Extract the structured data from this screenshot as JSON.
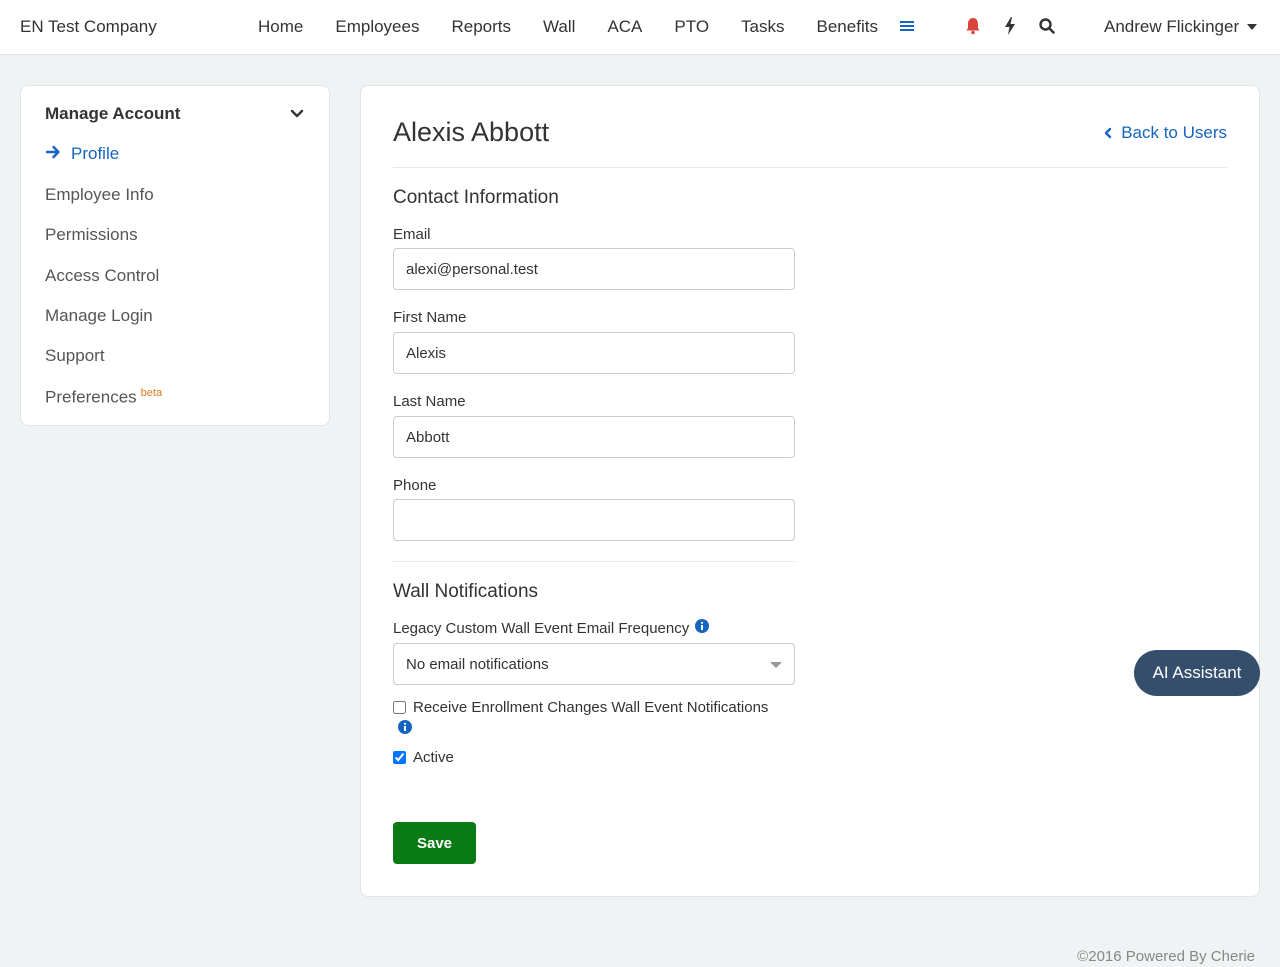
{
  "brand": "EN Test Company",
  "nav": {
    "links": [
      "Home",
      "Employees",
      "Reports",
      "Wall",
      "ACA",
      "PTO",
      "Tasks",
      "Benefits"
    ],
    "user": "Andrew Flickinger"
  },
  "sidebar": {
    "header": "Manage Account",
    "items": [
      {
        "label": "Profile"
      },
      {
        "label": "Employee Info"
      },
      {
        "label": "Permissions"
      },
      {
        "label": "Access Control"
      },
      {
        "label": "Manage Login"
      },
      {
        "label": "Support"
      },
      {
        "label": "Preferences",
        "badge": "beta"
      }
    ]
  },
  "main": {
    "title": "Alexis Abbott",
    "back_link": "Back to Users",
    "contact_section": "Contact Information",
    "fields": {
      "email_label": "Email",
      "email_value": "alexi@personal.test",
      "first_name_label": "First Name",
      "first_name_value": "Alexis",
      "last_name_label": "Last Name",
      "last_name_value": "Abbott",
      "phone_label": "Phone",
      "phone_value": ""
    },
    "wall_section": "Wall Notifications",
    "frequency_label": "Legacy Custom Wall Event Email Frequency",
    "frequency_value": "No email notifications",
    "enrollment_label": "Receive Enrollment Changes Wall Event Notifications",
    "enrollment_checked": false,
    "active_label": "Active",
    "active_checked": true,
    "save_label": "Save"
  },
  "ai_assistant": "AI Assistant",
  "footer": "©2016 Powered By Cherie",
  "colors": {
    "link": "#1565c0",
    "save": "#0a7a14",
    "ai": "#344e6b",
    "bell": "#d9443a",
    "beta": "#e07b1f"
  }
}
